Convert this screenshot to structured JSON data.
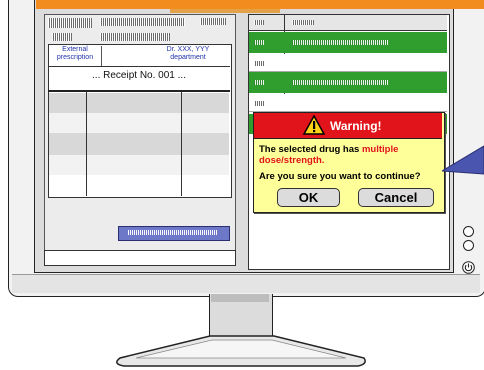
{
  "left_panel": {
    "header_cell_left": "External prescription",
    "header_cell_right": "Dr. XXX, YYY department",
    "receipt_title": "... Receipt No. 001 ..."
  },
  "dialog": {
    "title": "Warning!",
    "message_part1": "The selected drug has ",
    "message_highlight": "multiple dose/strength.",
    "message_question": "Are you sure you want to continue?",
    "ok_label": "OK",
    "cancel_label": "Cancel"
  },
  "colors": {
    "accent_orange": "#f28c1e",
    "row_green": "#2f9e2f",
    "dialog_red": "#e0141a",
    "dialog_yellow": "#ffff99",
    "highlight_red": "#e0141a",
    "pointer_blue": "#4a55b0",
    "button_gray": "#e6e6e6"
  },
  "icons": {
    "warning": "warning-triangle-icon",
    "power": "power-icon"
  }
}
